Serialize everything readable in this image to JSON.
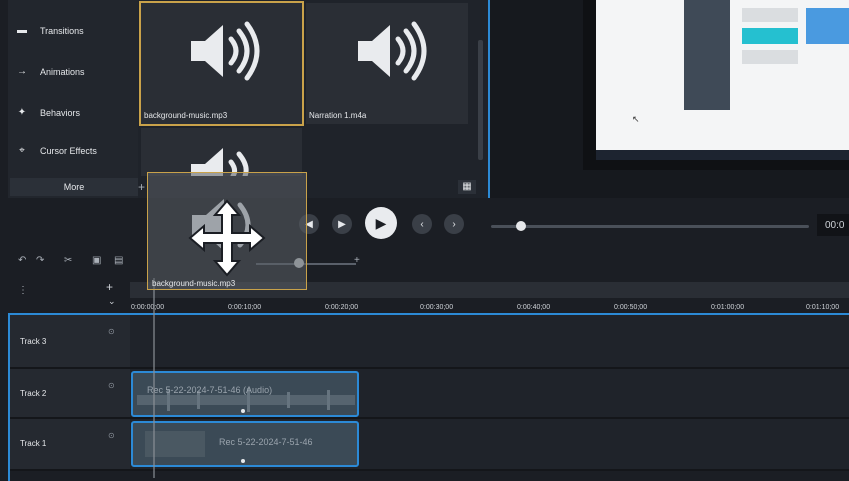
{
  "tools": {
    "items": [
      {
        "label": "Transitions",
        "icon": "transitions-icon"
      },
      {
        "label": "Animations",
        "icon": "animations-icon"
      },
      {
        "label": "Behaviors",
        "icon": "behaviors-icon"
      },
      {
        "label": "Cursor Effects",
        "icon": "cursor-icon"
      }
    ],
    "more_label": "More"
  },
  "media_bin": {
    "items": [
      {
        "label": "background-music.mp3",
        "selected": true
      },
      {
        "label": "Narration 1.m4a",
        "selected": false
      }
    ]
  },
  "preview": {
    "time_readout": "00:0"
  },
  "timeline": {
    "ruler_labels": [
      "0:00:00;00",
      "0:00:10;00",
      "0:00:20;00",
      "0:00:30;00",
      "0:00:40;00",
      "0:00:50;00",
      "0:01:00;00",
      "0:01:10;00"
    ],
    "tracks": [
      {
        "name": "Track 3",
        "clip": ""
      },
      {
        "name": "Track 2",
        "clip": "Rec 5-22-2024-7-51-46 (Audio)"
      },
      {
        "name": "Track 1",
        "clip": "Rec 5-22-2024-7-51-46"
      }
    ],
    "drag_label": "background-music.mp3",
    "add_track_label": "+"
  },
  "colors": {
    "accent": "#2c8ad6",
    "selection": "#c9a24a",
    "background": "#1b1e24"
  }
}
